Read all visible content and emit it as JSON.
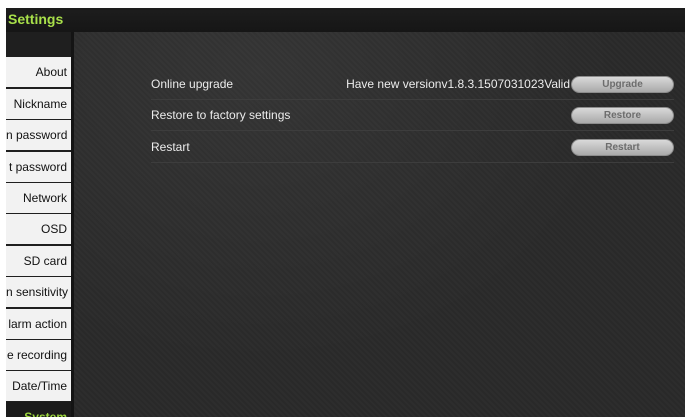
{
  "window": {
    "title": "Settings"
  },
  "sidebar": {
    "items": [
      {
        "label": "About",
        "active": false
      },
      {
        "label": "Nickname",
        "active": false
      },
      {
        "label": "n password",
        "active": false
      },
      {
        "label": "t password",
        "active": false
      },
      {
        "label": "Network",
        "active": false
      },
      {
        "label": "OSD",
        "active": false
      },
      {
        "label": "SD card",
        "active": false
      },
      {
        "label": "n sensitivity",
        "active": false
      },
      {
        "label": "larm action",
        "active": false
      },
      {
        "label": "e recording",
        "active": false
      },
      {
        "label": "Date/Time",
        "active": false
      },
      {
        "label": "System",
        "active": true
      }
    ]
  },
  "main": {
    "upgrade": {
      "label": "Online upgrade",
      "info": "Have new versionv1.8.3.1507031023Valid",
      "button": "Upgrade"
    },
    "restore": {
      "label": "Restore to factory settings",
      "button": "Restore"
    },
    "restart": {
      "label": "Restart",
      "button": "Restart"
    }
  },
  "colors": {
    "accent": "#9ed83f",
    "background": "#2a2a2a",
    "sidebar_item": "#f2f2f2"
  }
}
